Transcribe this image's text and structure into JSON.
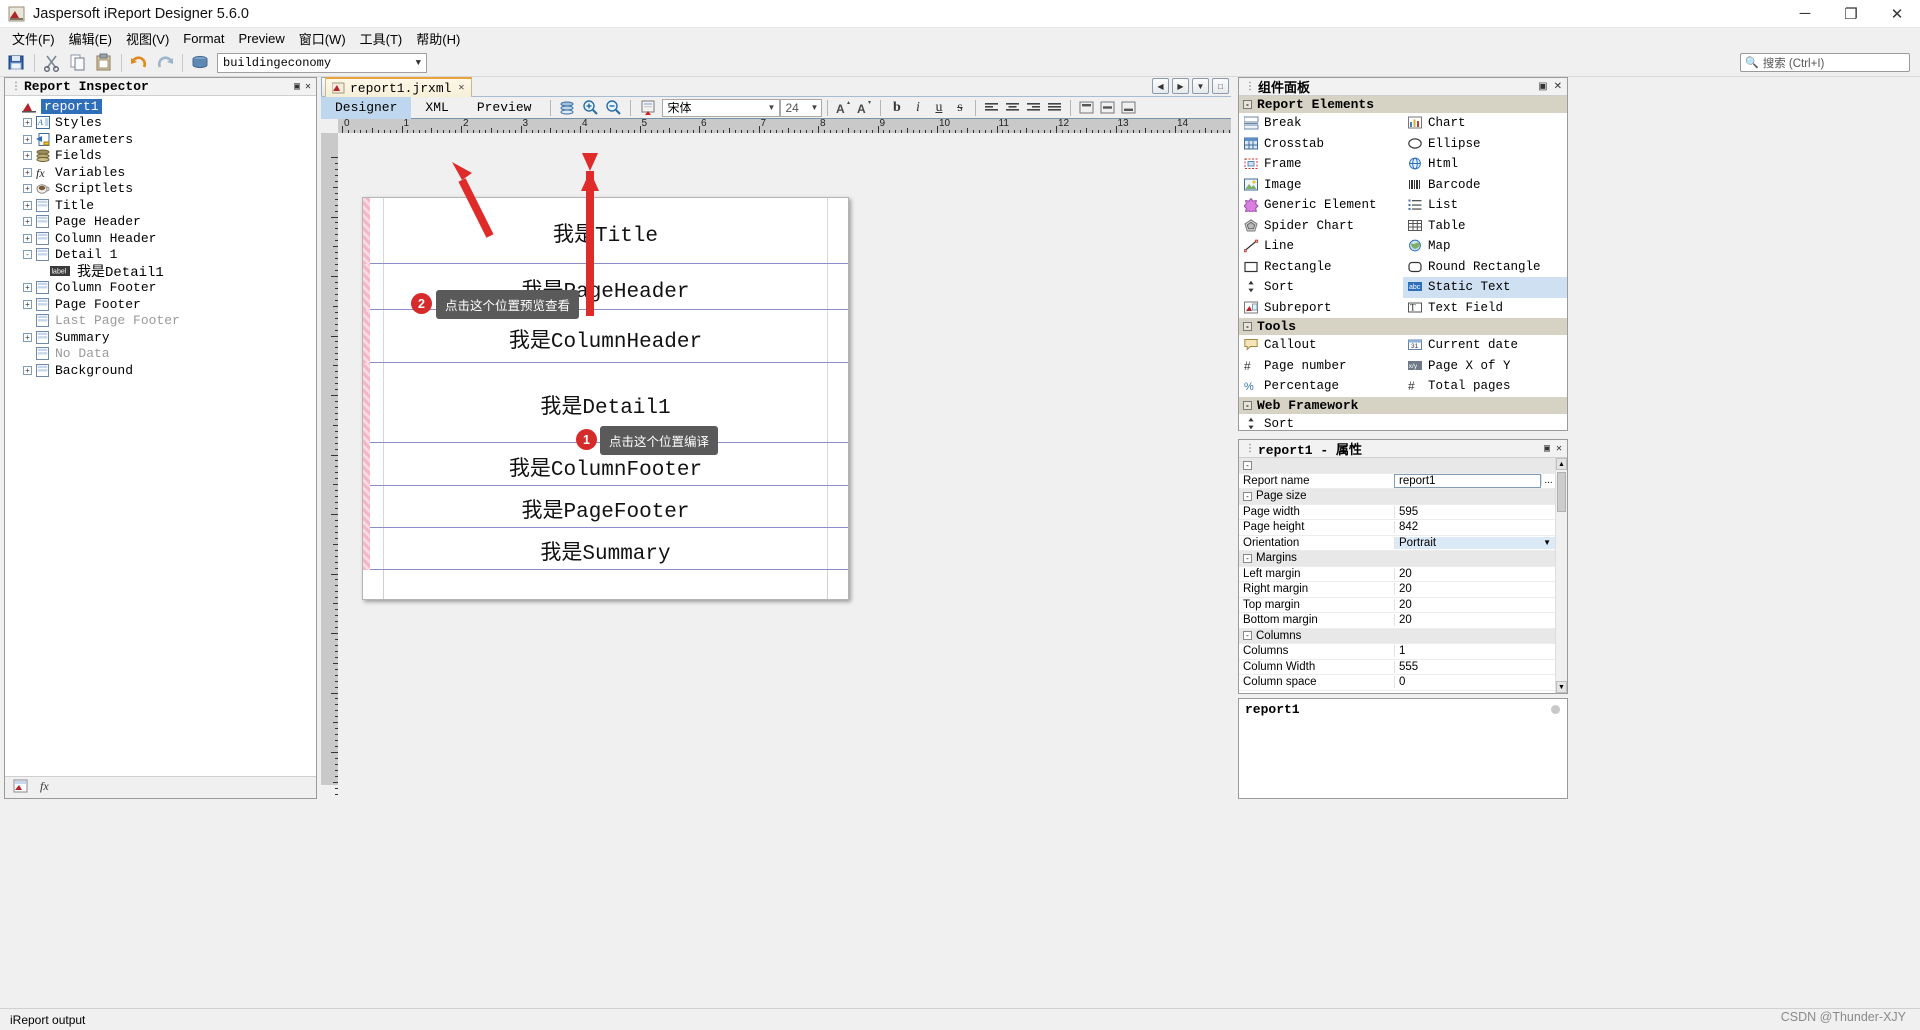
{
  "window": {
    "title": "Jaspersoft iReport Designer 5.6.0",
    "app_icon": "ireport-icon",
    "minimize": "─",
    "maximize": "❐",
    "close": "✕"
  },
  "menubar": {
    "items": [
      "文件(F)",
      "编辑(E)",
      "视图(V)",
      "Format",
      "Preview",
      "窗口(W)",
      "工具(T)",
      "帮助(H)"
    ]
  },
  "toolbar": {
    "icons": [
      "save-all-icon",
      "cut-icon",
      "copy-icon",
      "paste-icon",
      "undo-icon",
      "redo-icon",
      "datasource-icon"
    ],
    "datasource_value": "buildingeconomy",
    "search_placeholder": "搜索 (Ctrl+I)",
    "search_icon": "magnifier-icon"
  },
  "inspector": {
    "title": "Report Inspector",
    "tree": [
      {
        "label": "report1",
        "icon": "report-icon",
        "expander": "",
        "depth": 0,
        "selected": true
      },
      {
        "label": "Styles",
        "icon": "styles-icon",
        "expander": "+",
        "depth": 1
      },
      {
        "label": "Parameters",
        "icon": "parameters-icon",
        "expander": "+",
        "depth": 1
      },
      {
        "label": "Fields",
        "icon": "fields-icon",
        "expander": "+",
        "depth": 1
      },
      {
        "label": "Variables",
        "icon": "variables-icon",
        "expander": "+",
        "depth": 1
      },
      {
        "label": "Scriptlets",
        "icon": "scriptlets-icon",
        "expander": "+",
        "depth": 1
      },
      {
        "label": "Title",
        "icon": "band-icon",
        "expander": "+",
        "depth": 1
      },
      {
        "label": "Page Header",
        "icon": "band-icon",
        "expander": "+",
        "depth": 1
      },
      {
        "label": "Column Header",
        "icon": "band-icon",
        "expander": "+",
        "depth": 1
      },
      {
        "label": "Detail 1",
        "icon": "band-icon",
        "expander": "-",
        "depth": 1
      },
      {
        "label": "我是Detail1",
        "icon": "label-icon",
        "expander": "",
        "depth": 2
      },
      {
        "label": "Column Footer",
        "icon": "band-icon",
        "expander": "+",
        "depth": 1
      },
      {
        "label": "Page Footer",
        "icon": "band-icon",
        "expander": "+",
        "depth": 1
      },
      {
        "label": "Last Page Footer",
        "icon": "band-icon",
        "expander": "",
        "depth": 1,
        "dim": true
      },
      {
        "label": "Summary",
        "icon": "band-icon",
        "expander": "+",
        "depth": 1
      },
      {
        "label": "No Data",
        "icon": "band-icon",
        "expander": "",
        "depth": 1,
        "dim": true
      },
      {
        "label": "Background",
        "icon": "band-icon",
        "expander": "+",
        "depth": 1
      }
    ],
    "footer_icons": [
      "report-thumb-icon",
      "fx-icon"
    ]
  },
  "editor": {
    "file_tab": "report1.jrxml",
    "file_tab_close": "✕",
    "view_tabs": [
      {
        "label": "Designer",
        "active": true
      },
      {
        "label": "XML",
        "active": false
      },
      {
        "label": "Preview",
        "active": false
      }
    ],
    "toolbar_icons": [
      "stack-icon",
      "zoom-in-icon",
      "zoom-out-icon",
      "preview-run-icon"
    ],
    "font_family": "宋体",
    "font_size": "24",
    "format_icons": [
      "increase-font-icon",
      "decrease-font-icon",
      "bold-icon",
      "italic-icon",
      "underline-icon",
      "strikethrough-icon",
      "align-left-icon",
      "align-center-icon",
      "align-right-icon",
      "align-justify-icon",
      "valign-top-icon",
      "valign-middle-icon",
      "valign-bottom-icon"
    ],
    "ruler_ticks": [
      "0",
      "1",
      "2",
      "3",
      "4",
      "5",
      "6",
      "7",
      "8",
      "9",
      "10",
      "11",
      "12",
      "13",
      "14"
    ],
    "bands": [
      {
        "name": "Title",
        "text": "我是Title"
      },
      {
        "name": "Page Header",
        "text": "我是PageHeader"
      },
      {
        "name": "Column Header",
        "text": "我是ColumnHeader"
      },
      {
        "name": "Detail 1",
        "text": "我是Detail1"
      },
      {
        "name": "Column Footer",
        "text": "我是ColumnFooter"
      },
      {
        "name": "Page Footer",
        "text": "我是PageFooter"
      },
      {
        "name": "Summary",
        "text": "我是Summary"
      }
    ],
    "annotations": [
      {
        "step": "1",
        "text": "点击这个位置编译"
      },
      {
        "step": "2",
        "text": "点击这个位置预览查看"
      }
    ],
    "annotation_color": "#e02b2b"
  },
  "palette": {
    "title": "组件面板",
    "groups": [
      {
        "name": "Report Elements",
        "items": [
          {
            "label": "Break",
            "icon": "break-icon"
          },
          {
            "label": "Chart",
            "icon": "chart-icon"
          },
          {
            "label": "Crosstab",
            "icon": "crosstab-icon"
          },
          {
            "label": "Ellipse",
            "icon": "ellipse-icon"
          },
          {
            "label": "Frame",
            "icon": "frame-icon"
          },
          {
            "label": "Html",
            "icon": "html-icon"
          },
          {
            "label": "Image",
            "icon": "image-icon"
          },
          {
            "label": "Barcode",
            "icon": "barcode-icon"
          },
          {
            "label": "Generic Element",
            "icon": "generic-element-icon"
          },
          {
            "label": "List",
            "icon": "list-icon"
          },
          {
            "label": "Spider Chart",
            "icon": "spider-chart-icon"
          },
          {
            "label": "Table",
            "icon": "table-icon"
          },
          {
            "label": "Line",
            "icon": "line-icon"
          },
          {
            "label": "Map",
            "icon": "map-icon"
          },
          {
            "label": "Rectangle",
            "icon": "rectangle-icon"
          },
          {
            "label": "Round Rectangle",
            "icon": "round-rectangle-icon"
          },
          {
            "label": "Sort",
            "icon": "sort-icon"
          },
          {
            "label": "Static Text",
            "icon": "static-text-icon",
            "selected": true
          },
          {
            "label": "Subreport",
            "icon": "subreport-icon"
          },
          {
            "label": "Text Field",
            "icon": "text-field-icon"
          }
        ]
      },
      {
        "name": "Tools",
        "items": [
          {
            "label": "Callout",
            "icon": "callout-icon"
          },
          {
            "label": "Current date",
            "icon": "current-date-icon"
          },
          {
            "label": "Page number",
            "icon": "page-number-icon"
          },
          {
            "label": "Page X of Y",
            "icon": "page-x-of-y-icon"
          },
          {
            "label": "Percentage",
            "icon": "percentage-icon"
          },
          {
            "label": "Total pages",
            "icon": "total-pages-icon"
          }
        ]
      },
      {
        "name": "Web Framework",
        "items": [
          {
            "label": "Sort",
            "icon": "sort-icon"
          }
        ]
      }
    ]
  },
  "properties": {
    "title": "report1 - 属性",
    "rows": [
      {
        "type": "cat",
        "name": "",
        "value": ""
      },
      {
        "type": "prop",
        "name": "Report name",
        "value": "report1",
        "editing": true,
        "ellipsis": "..."
      },
      {
        "type": "cat",
        "name": "Page size",
        "value": ""
      },
      {
        "type": "prop",
        "name": "Page width",
        "value": "595"
      },
      {
        "type": "prop",
        "name": "Page height",
        "value": "842"
      },
      {
        "type": "prop",
        "name": "Orientation",
        "value": "Portrait",
        "combo": true
      },
      {
        "type": "cat",
        "name": "Margins",
        "value": ""
      },
      {
        "type": "prop",
        "name": "Left margin",
        "value": "20"
      },
      {
        "type": "prop",
        "name": "Right margin",
        "value": "20"
      },
      {
        "type": "prop",
        "name": "Top margin",
        "value": "20"
      },
      {
        "type": "prop",
        "name": "Bottom margin",
        "value": "20"
      },
      {
        "type": "cat",
        "name": "Columns",
        "value": ""
      },
      {
        "type": "prop",
        "name": "Columns",
        "value": "1"
      },
      {
        "type": "prop",
        "name": "Column Width",
        "value": "555"
      },
      {
        "type": "prop",
        "name": "Column space",
        "value": "0"
      }
    ]
  },
  "description": {
    "title": "report1"
  },
  "statusbar": {
    "text": "iReport output"
  },
  "watermark": "CSDN @Thunder-XJY"
}
